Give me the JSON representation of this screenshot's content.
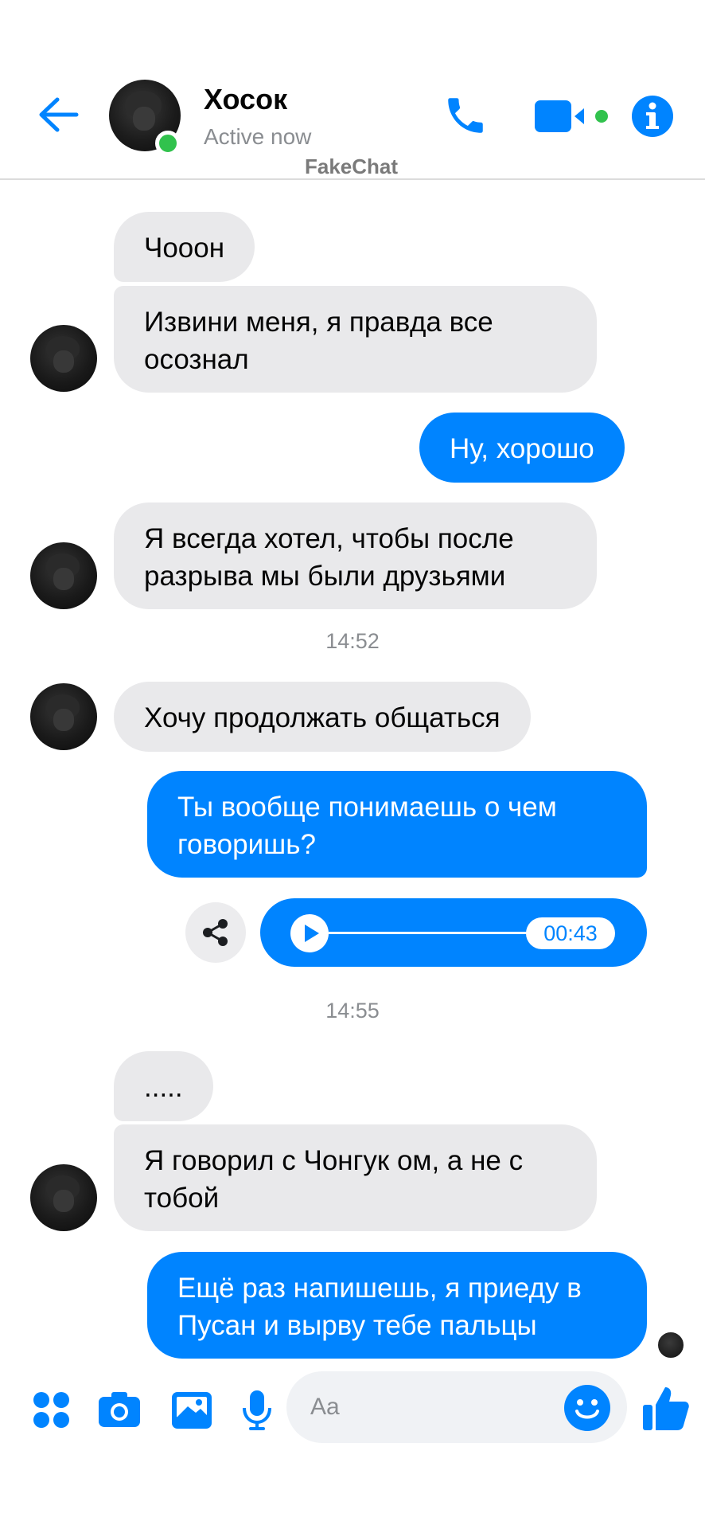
{
  "header": {
    "contact_name": "Хосок",
    "status": "Active now",
    "watermark": "FakeChat"
  },
  "messages": [
    {
      "text": "Чооон"
    },
    {
      "text": "Извини меня, я правда все осознал"
    },
    {
      "text": "Ну, хорошо"
    },
    {
      "text": "Я всегда хотел, чтобы после разрыва мы были друзьями"
    },
    {
      "text": "Хочу продолжать общаться"
    },
    {
      "text": "Ты вообще понимаешь о чем говоришь?"
    },
    {
      "text": "....."
    },
    {
      "text": "Я говорил с Чонгук ом, а не с тобой"
    },
    {
      "text": "Ещё раз напишешь, я приеду в Пусан и вырву тебе пальцы"
    }
  ],
  "timestamps": [
    "14:52",
    "14:55"
  ],
  "audio": {
    "duration": "00:43",
    "progress": 0
  },
  "composer": {
    "placeholder": "Aa"
  },
  "icons": [
    "back-arrow-icon",
    "phone-icon",
    "video-camera-icon",
    "info-icon",
    "apps-grid-icon",
    "camera-icon",
    "gallery-icon",
    "microphone-icon",
    "emoji-icon",
    "thumbs-up-icon",
    "share-icon",
    "play-icon"
  ],
  "colors": {
    "accent": "#0084ff",
    "incoming_bubble": "#e9e9eb",
    "online": "#31c24d",
    "secondary_text": "#8a8d91"
  }
}
